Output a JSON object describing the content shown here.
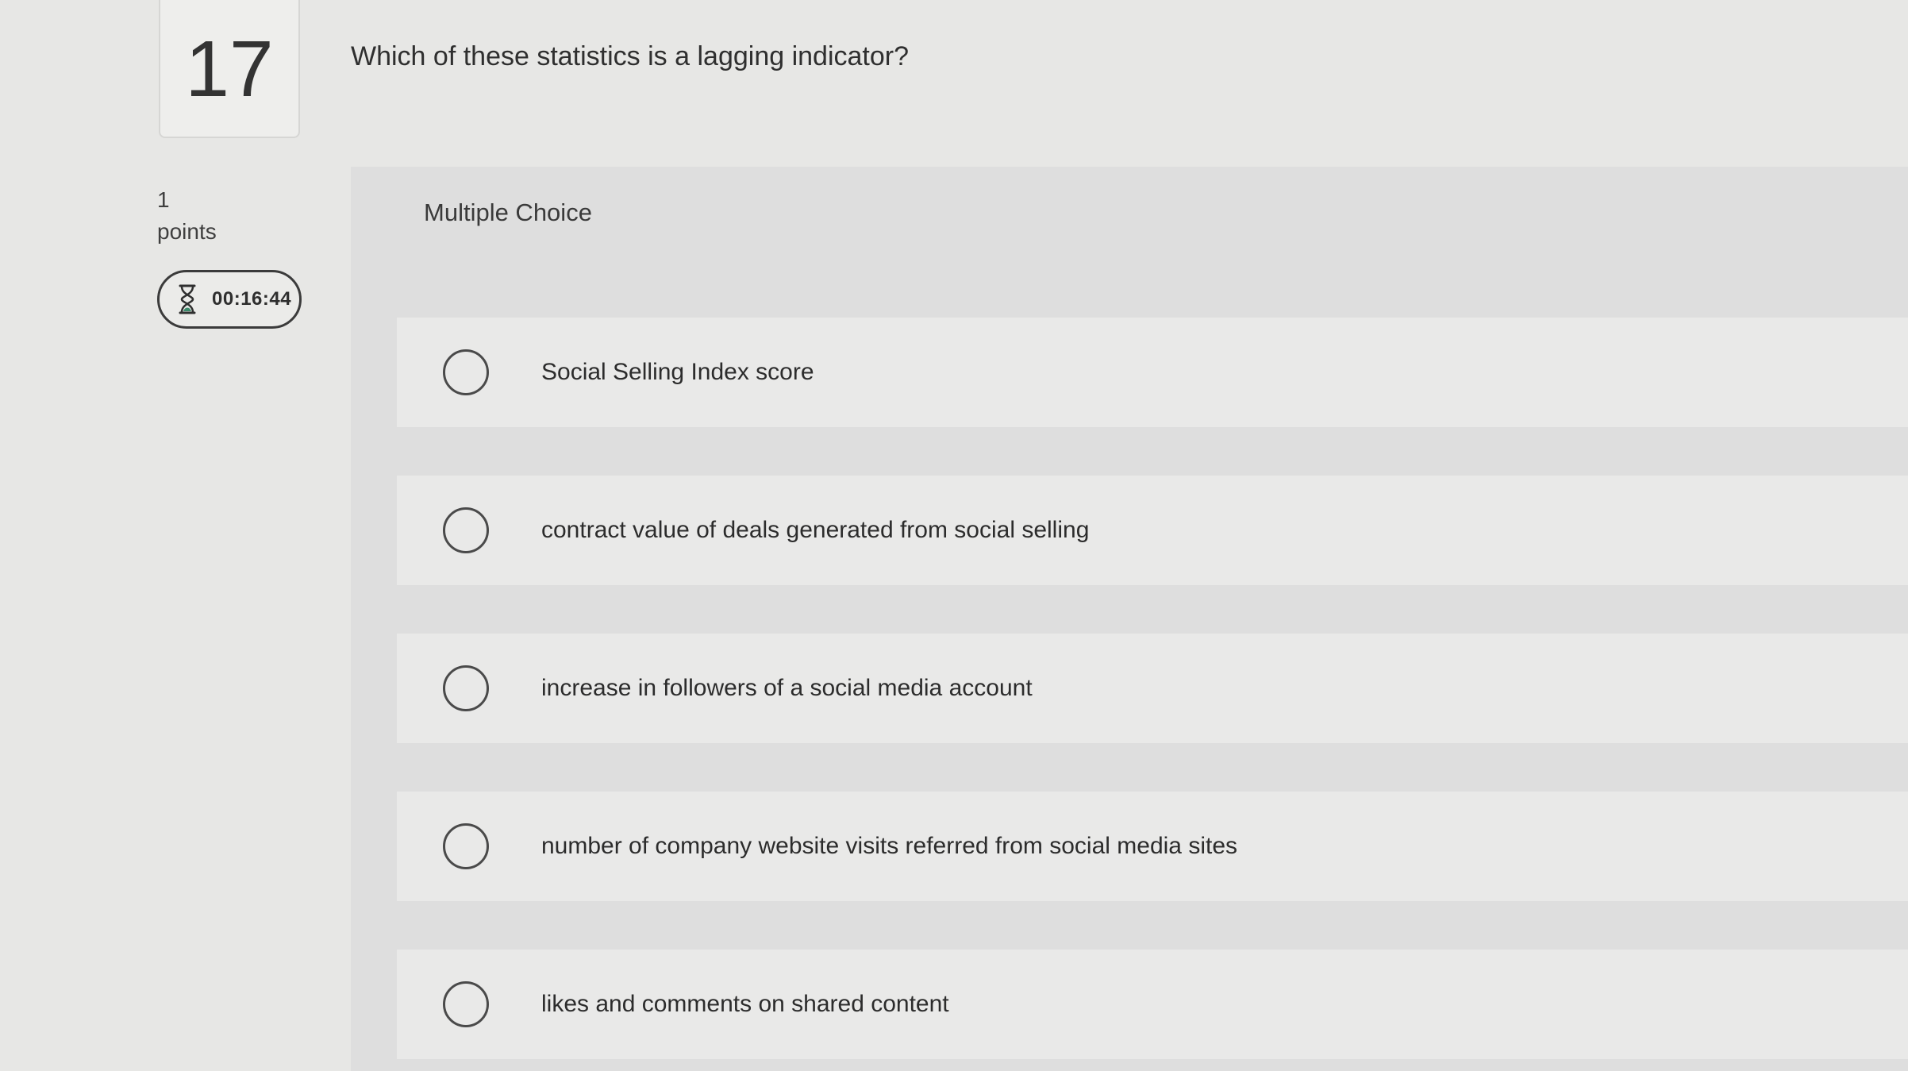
{
  "question": {
    "number": "17",
    "text": "Which of these statistics is a lagging indicator?",
    "points_value": "1",
    "points_label": "points",
    "timer": "00:16:44"
  },
  "choice_panel": {
    "header": "Multiple Choice",
    "options": [
      {
        "label": "Social Selling Index score"
      },
      {
        "label": "contract value of deals generated from social selling"
      },
      {
        "label": "increase in followers of a social media account"
      },
      {
        "label": "number of company website visits referred from social media sites"
      },
      {
        "label": "likes and comments on shared content"
      }
    ]
  },
  "icons": {
    "timer": "hourglass-icon",
    "option": "radio-button"
  }
}
